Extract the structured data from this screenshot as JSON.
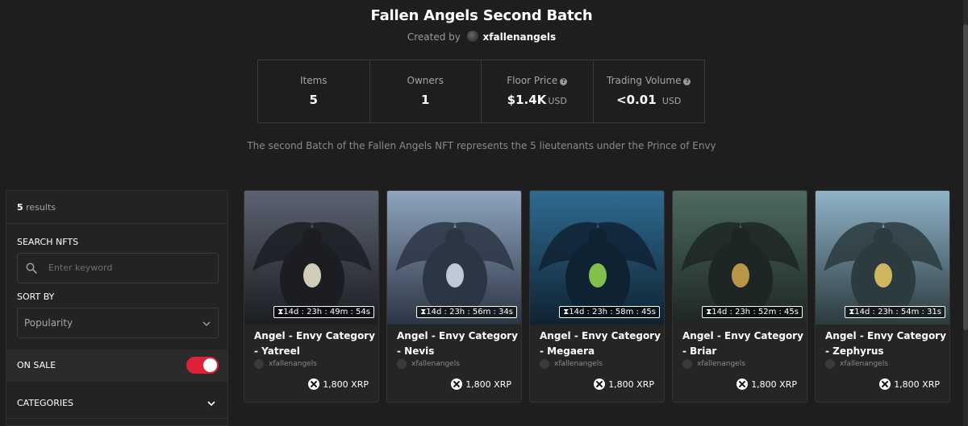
{
  "collection": {
    "title": "Fallen Angels Second Batch",
    "created_by_label": "Created by",
    "creator": "xfallenangels",
    "description": "The second Batch of the Fallen Angels NFT represents the 5 lieutenants under the Prince of Envy"
  },
  "stats": [
    {
      "label": "Items",
      "value": "5",
      "unit": ""
    },
    {
      "label": "Owners",
      "value": "1",
      "unit": ""
    },
    {
      "label": "Floor Price",
      "value": "$1.4K",
      "unit": "USD"
    },
    {
      "label": "Trading Volume",
      "value": "<0.01",
      "unit": "USD"
    }
  ],
  "sidebar": {
    "results_count": "5",
    "results_label": "results",
    "search_label": "SEARCH NFTS",
    "search_placeholder": "Enter keyword",
    "sort_label": "SORT BY",
    "sort_value": "Popularity",
    "on_sale_label": "ON SALE",
    "on_sale_enabled": true,
    "categories_label": "CATEGORIES"
  },
  "items": [
    {
      "name": "Angel - Envy Category - Yatreel",
      "owner": "xfallenangels",
      "price": "1,800 XRP",
      "timer": "14d : 23h : 49m : 54s",
      "palette": [
        "#5b6270",
        "#1b1d22",
        "#e6e0c8"
      ]
    },
    {
      "name": "Angel - Envy Category - Nevis",
      "owner": "xfallenangels",
      "price": "1,800 XRP",
      "timer": "14d : 23h : 56m : 34s",
      "palette": [
        "#8fa4bf",
        "#2c3544",
        "#cfd9e6"
      ]
    },
    {
      "name": "Angel - Envy Category - Megaera",
      "owner": "xfallenangels",
      "price": "1,800 XRP",
      "timer": "14d : 23h : 58m : 45s",
      "palette": [
        "#2f6b91",
        "#0f2232",
        "#8fd14f"
      ]
    },
    {
      "name": "Angel - Envy Category - Briar",
      "owner": "xfallenangels",
      "price": "1,800 XRP",
      "timer": "14d : 23h : 52m : 45s",
      "palette": [
        "#4e6a62",
        "#1d2624",
        "#c9a44b"
      ]
    },
    {
      "name": "Angel - Envy Category - Zephyrus",
      "owner": "xfallenangels",
      "price": "1,800 XRP",
      "timer": "14d : 23h : 54m : 31s",
      "palette": [
        "#8fb3c8",
        "#2b3b3e",
        "#e3c463"
      ]
    }
  ]
}
